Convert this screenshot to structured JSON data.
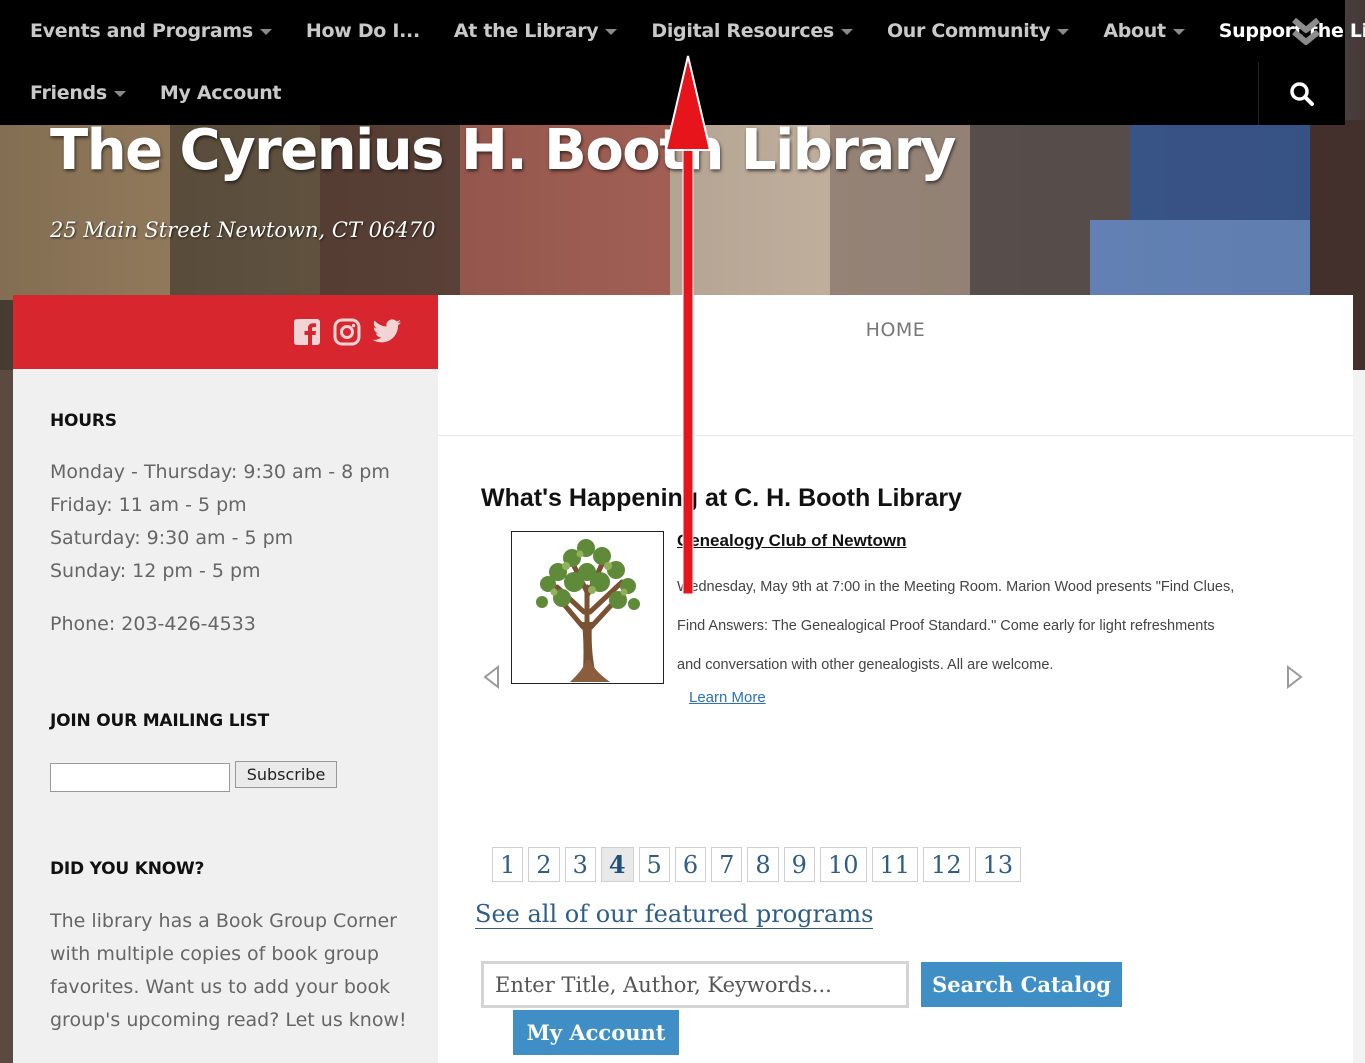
{
  "nav": {
    "row1": [
      {
        "label": "Events and Programs",
        "dropdown": true
      },
      {
        "label": "How Do I...",
        "dropdown": false
      },
      {
        "label": "At the Library",
        "dropdown": true
      },
      {
        "label": "Digital Resources",
        "dropdown": true
      },
      {
        "label": "Our Community",
        "dropdown": true
      },
      {
        "label": "About",
        "dropdown": true
      },
      {
        "label": "Support the Library",
        "dropdown": false
      }
    ],
    "row2": [
      {
        "label": "Friends",
        "dropdown": true
      },
      {
        "label": "My Account",
        "dropdown": false
      }
    ],
    "expand_icon": "double-chevron-down-icon",
    "search_icon": "search-icon"
  },
  "site": {
    "title": "The Cyrenius H. Booth Library",
    "address": "25 Main Street Newtown, CT 06470"
  },
  "sidebar": {
    "social": [
      "facebook-icon",
      "instagram-icon",
      "twitter-icon"
    ],
    "hours_title": "HOURS",
    "hours": [
      "Monday - Thursday: 9:30 am - 8 pm",
      "Friday: 11 am - 5 pm",
      "Saturday: 9:30 am - 5 pm",
      "Sunday: 12 pm - 5 pm"
    ],
    "phone": "Phone: 203-426-4533",
    "mailing_title": "JOIN OUR MAILING LIST",
    "mailing_value": "",
    "subscribe_label": "Subscribe",
    "did_you_know_title": "DID YOU KNOW?",
    "did_you_know_text": "The library has a Book Group Corner with multiple copies of book group favorites. Want us to add your book group's upcoming read? Let us know!"
  },
  "main": {
    "breadcrumb": "HOME",
    "happening_title": "What's Happening at C. H. Booth Library",
    "slide": {
      "title": "Genealogy Club of Newtown",
      "description": "Wednesday, May 9th at 7:00 in the Meeting Room. Marion Wood presents \"Find Clues, Find Answers: The Genealogical Proof Standard.\" Come early for light refreshments and conversation with other genealogists. All are welcome.",
      "learn_more": "Learn More",
      "image_icon": "tree-icon"
    },
    "pages": [
      "1",
      "2",
      "3",
      "4",
      "5",
      "6",
      "7",
      "8",
      "9",
      "10",
      "11",
      "12",
      "13"
    ],
    "active_page": "4",
    "all_programs_link": "See all of our featured programs",
    "catalog_placeholder": "Enter Title, Author, Keywords...",
    "catalog_value": "",
    "search_catalog_label": "Search Catalog",
    "my_account_label": "My Account"
  },
  "colors": {
    "nav_bg": "#000000",
    "social_bar": "#d7262d",
    "button_blue": "#3f8fc6",
    "link_blue": "#2e5e86",
    "annotation_arrow": "#e8141c"
  }
}
